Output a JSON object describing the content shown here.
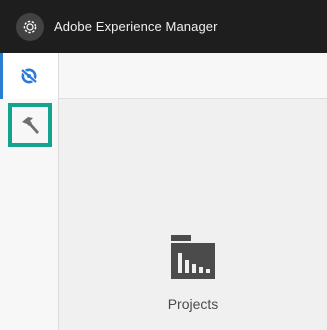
{
  "header": {
    "title": "Adobe Experience Manager",
    "logo_icon": "aem-logo-icon"
  },
  "rail": {
    "items": [
      {
        "name": "navigation",
        "icon": "compass-icon",
        "active": true
      },
      {
        "name": "tools",
        "icon": "hammer-icon",
        "highlighted": true
      }
    ]
  },
  "main": {
    "cards": [
      {
        "label": "Projects",
        "icon": "projects-folder-icon"
      }
    ]
  },
  "colors": {
    "header_bg": "#1e1e1e",
    "accent_blue": "#2b7cd3",
    "highlight_teal": "#15a38e",
    "icon_gray": "#4b4b4b"
  }
}
